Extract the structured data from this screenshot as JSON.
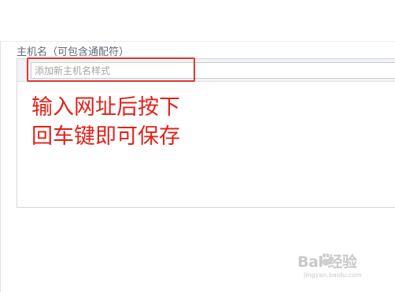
{
  "form": {
    "field_label": "主机名（可包含通配符）",
    "input_placeholder": "添加新主机名样式",
    "input_value": ""
  },
  "annotation": {
    "line1": "输入网址后按下",
    "line2": "回车键即可保存"
  },
  "watermark": {
    "brand": "Bai  经验",
    "url": "jingyan.baidu.com"
  },
  "colors": {
    "highlight": "#e0392b",
    "annotation_text": "#e0221a"
  }
}
